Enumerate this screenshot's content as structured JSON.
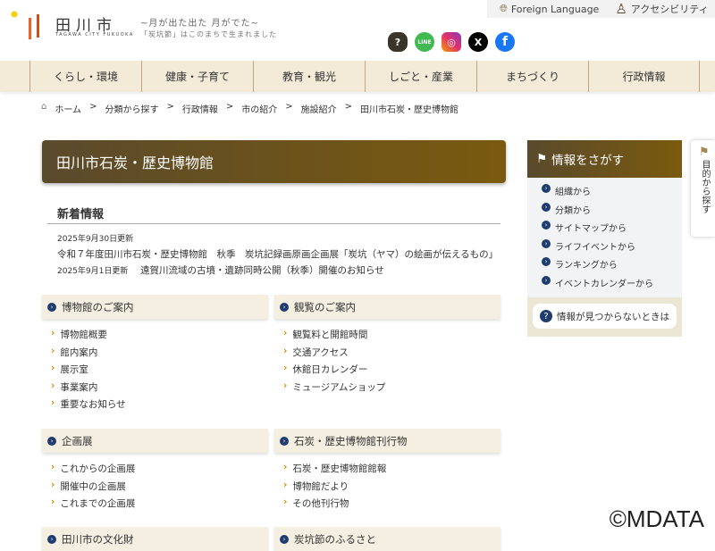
{
  "header": {
    "logo": "田川市",
    "logo_sub": "TAGAWA CITY FUKUOKA",
    "slogan1": "~月が出た出た 月がでた~",
    "slogan2": "「炭坑節」はこのまちで生まれました",
    "foreign": "Foreign Language",
    "accessibility": "アクセシビリティ",
    "social": [
      {
        "name": "faq",
        "color": "#3b3428"
      },
      {
        "name": "line",
        "color": "#3fb950"
      },
      {
        "name": "instagram",
        "color": "#e1306c"
      },
      {
        "name": "x",
        "color": "#000000"
      },
      {
        "name": "facebook",
        "color": "#1877f2"
      }
    ]
  },
  "nav": [
    "くらし・環境",
    "健康・子育て",
    "教育・観光",
    "しごと・産業",
    "まちづくり",
    "行政情報"
  ],
  "breadcrumb": [
    "ホーム",
    "分類から探す",
    "行政情報",
    "市の紹介",
    "施設紹介",
    "田川市石炭・歴史博物館"
  ],
  "title": "田川市石炭・歴史博物館",
  "news": {
    "heading": "新着情報",
    "items": [
      {
        "date": "2025年9月30日更新",
        "text": "令和７年度田川市石炭・歴史博物館　秋季　炭坑記録画原画企画展「炭坑（ヤマ）の絵画が伝えるもの」"
      },
      {
        "date": "2025年9月1日更新",
        "text": "遠賀川流域の古墳・遺跡同時公開（秋季）開催のお知らせ"
      }
    ]
  },
  "boxes": [
    {
      "title": "博物館のご案内",
      "links": [
        "博物館概要",
        "館内案内",
        "展示室",
        "事業案内",
        "重要なお知らせ"
      ]
    },
    {
      "title": "観覧のご案内",
      "links": [
        "観覧料と開館時間",
        "交通アクセス",
        "休館日カレンダー",
        "ミュージアムショップ"
      ]
    },
    {
      "title": "企画展",
      "links": [
        "これからの企画展",
        "開催中の企画展",
        "これまでの企画展"
      ]
    },
    {
      "title": "石炭・歴史博物館刊行物",
      "links": [
        "石炭・歴史博物館館報",
        "博物館だより",
        "その他刊行物"
      ]
    },
    {
      "title": "田川市の文化財",
      "links": []
    },
    {
      "title": "炭坑節のふるさと",
      "links": []
    }
  ],
  "sidebar": {
    "title": "情報をさがす",
    "links": [
      "組織から",
      "分類から",
      "サイトマップから",
      "ライフイベントから",
      "ランキングから",
      "イベントカレンダーから"
    ],
    "help": "情報が見つからないときは"
  },
  "side_tab": "目的から探す",
  "watermark": "©MDATA"
}
